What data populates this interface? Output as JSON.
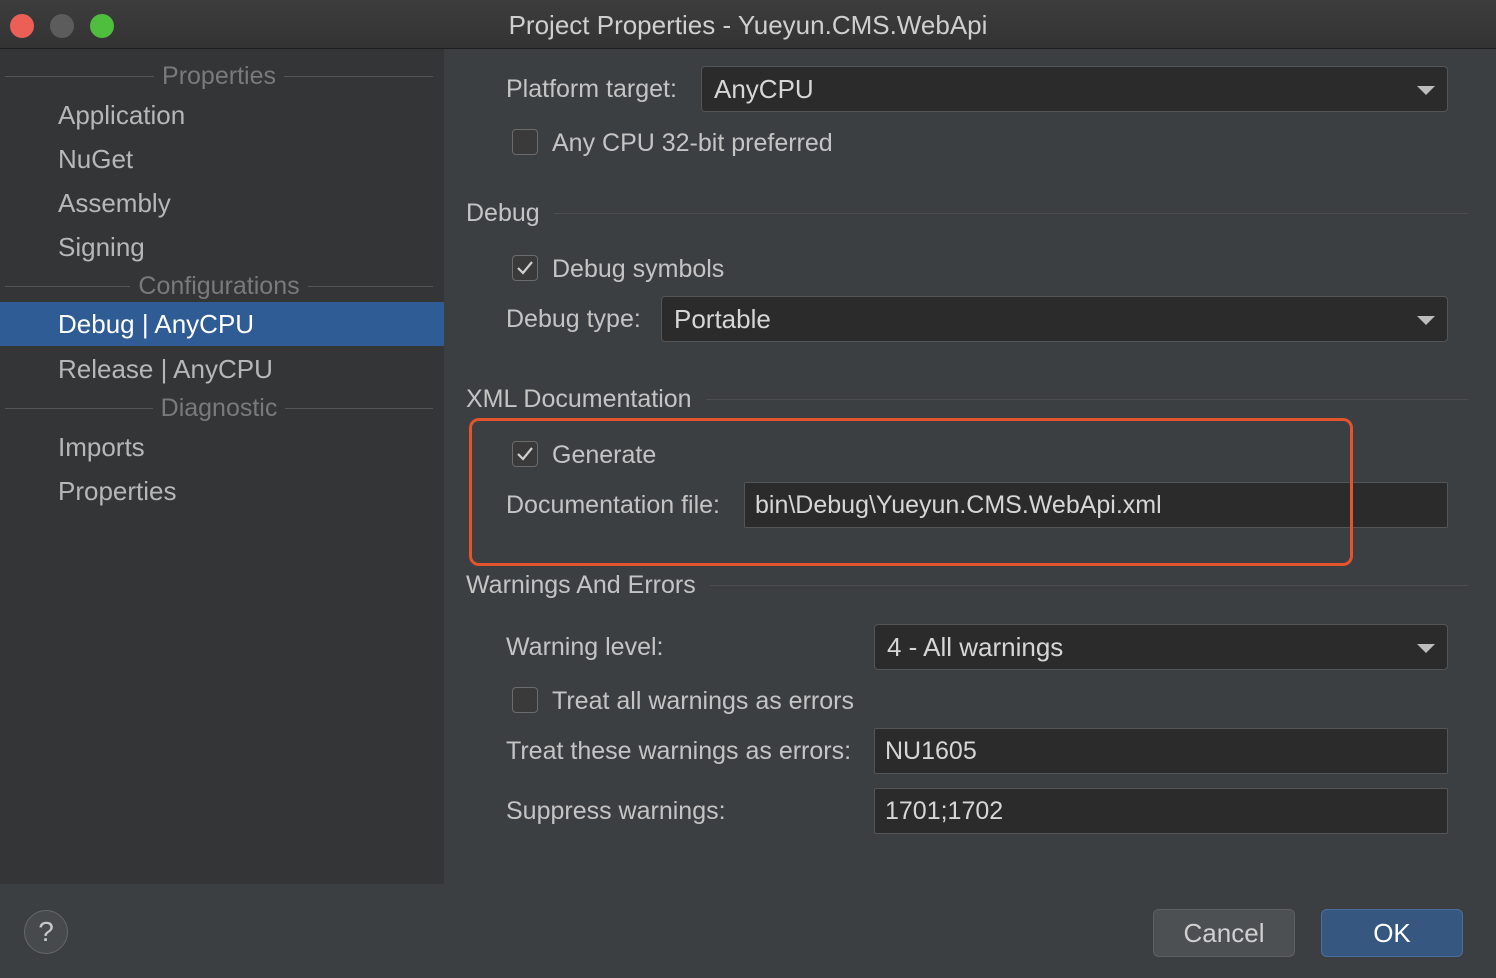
{
  "window": {
    "title": "Project Properties - Yueyun.CMS.WebApi"
  },
  "sidebar": {
    "sections": [
      {
        "header": "Properties"
      },
      {
        "header": "Configurations"
      },
      {
        "header": "Diagnostic"
      }
    ],
    "items": [
      {
        "label": "Application"
      },
      {
        "label": "NuGet"
      },
      {
        "label": "Assembly"
      },
      {
        "label": "Signing"
      },
      {
        "label": "Debug | AnyCPU",
        "selected": true
      },
      {
        "label": "Release | AnyCPU"
      },
      {
        "label": "Imports"
      },
      {
        "label": "Properties"
      }
    ]
  },
  "platform": {
    "target_label": "Platform target:",
    "target_value": "AnyCPU",
    "prefer32_label": "Any CPU 32-bit preferred",
    "prefer32_checked": false
  },
  "debug": {
    "group_title": "Debug",
    "symbols_label": "Debug symbols",
    "symbols_checked": true,
    "type_label": "Debug type:",
    "type_value": "Portable"
  },
  "xml_doc": {
    "group_title": "XML Documentation",
    "generate_label": "Generate",
    "generate_checked": true,
    "file_label": "Documentation file:",
    "file_value": "bin\\Debug\\Yueyun.CMS.WebApi.xml"
  },
  "warnings": {
    "group_title": "Warnings And Errors",
    "level_label": "Warning level:",
    "level_value": "4 - All warnings",
    "treat_all_label": "Treat all warnings as errors",
    "treat_all_checked": false,
    "treat_these_label": "Treat these warnings as errors:",
    "treat_these_value": "NU1605",
    "suppress_label": "Suppress warnings:",
    "suppress_value": "1701;1702"
  },
  "footer": {
    "help_label": "?",
    "cancel_label": "Cancel",
    "ok_label": "OK"
  },
  "colors": {
    "accent": "#2f5c94",
    "highlight_border": "#e5532c",
    "background": "#3c3f41"
  }
}
